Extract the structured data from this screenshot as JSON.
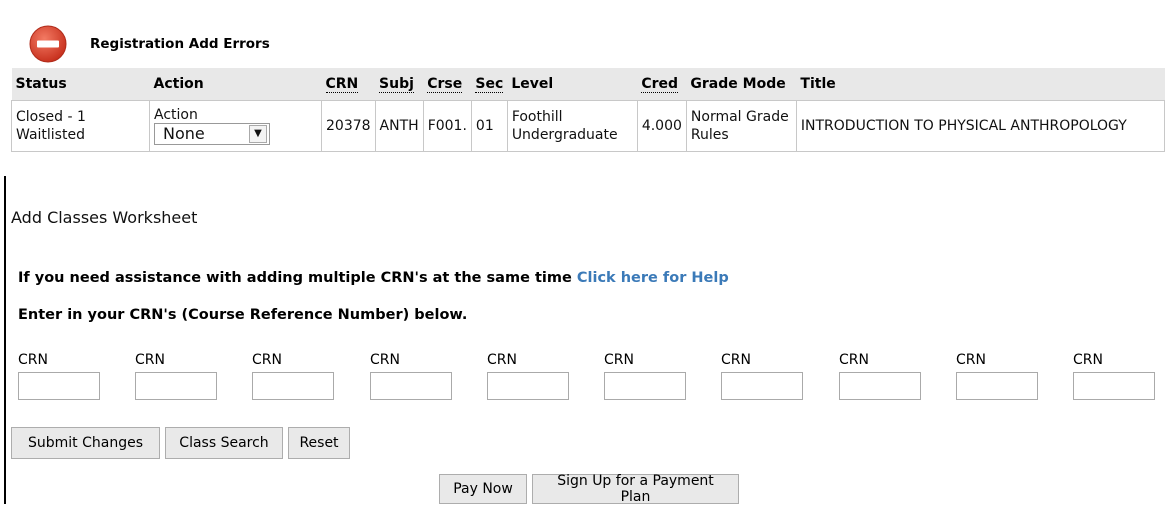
{
  "errors": {
    "title": "Registration Add Errors",
    "icon": "minus-circle-icon",
    "accent_color": "#d9422e",
    "columns": [
      "Status",
      "Action",
      "CRN",
      "Subj",
      "Crse",
      "Sec",
      "Level",
      "Cred",
      "Grade Mode",
      "Title"
    ],
    "row": {
      "status": "Closed - 1 Waitlisted",
      "action_label": "Action",
      "action_value": "None",
      "crn": "20378",
      "subj": "ANTH",
      "crse": "F001.",
      "sec": "01",
      "level": "Foothill Undergraduate",
      "cred": "4.000",
      "grade_mode": "Normal Grade Rules",
      "title": "INTRODUCTION TO PHYSICAL ANTHROPOLOGY"
    }
  },
  "worksheet": {
    "title": "Add Classes Worksheet",
    "help_text": "If you need assistance with adding multiple CRN's at the same time",
    "help_link": "Click here for Help",
    "enter_text": "Enter in your CRN's (Course Reference Number) below.",
    "crn_labels": [
      "CRN",
      "CRN",
      "CRN",
      "CRN",
      "CRN",
      "CRN",
      "CRN",
      "CRN",
      "CRN",
      "CRN"
    ],
    "crn_values": [
      "",
      "",
      "",
      "",
      "",
      "",
      "",
      "",
      "",
      ""
    ]
  },
  "buttons": {
    "submit": "Submit Changes",
    "search": "Class Search",
    "reset": "Reset",
    "pay_now": "Pay Now",
    "payment_plan": "Sign Up for a Payment Plan"
  },
  "colors": {
    "link": "#3b7ab8",
    "header_bg": "#e8e8e8"
  }
}
